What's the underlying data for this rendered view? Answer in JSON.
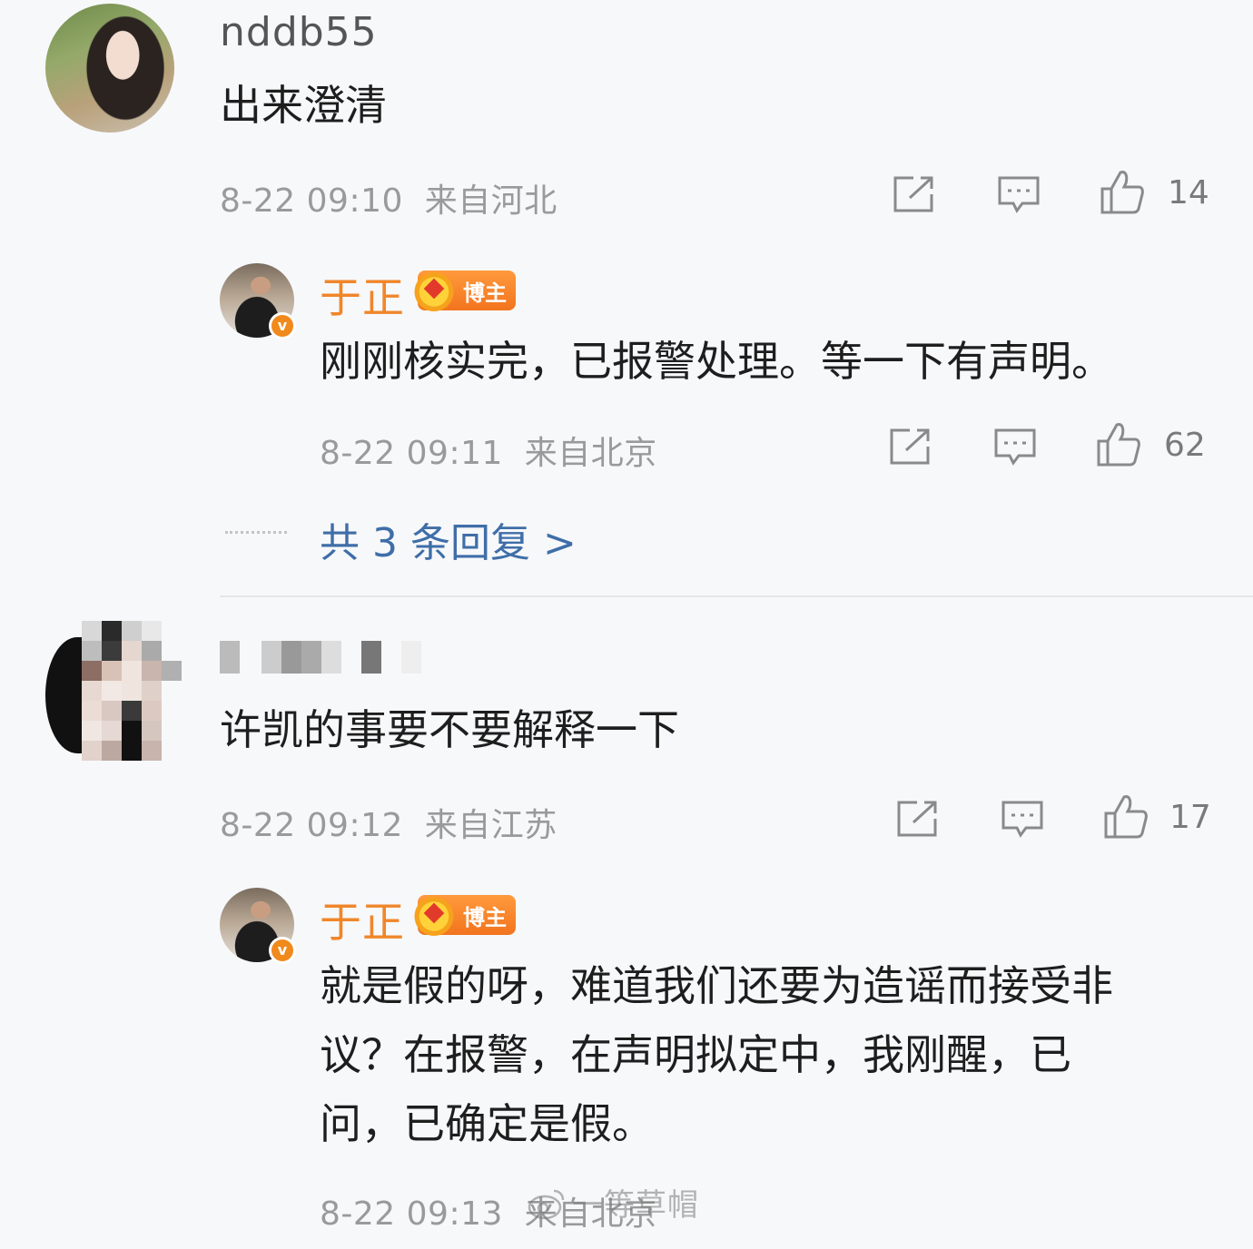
{
  "comments": [
    {
      "username": "nddb55",
      "text": "出来澄清",
      "time": "8-22 09:10",
      "location": "来自河北",
      "likes": "14",
      "reply": {
        "username": "于正",
        "badge": "博主",
        "text": "刚刚核实完，已报警处理。等一下有声明。",
        "time": "8-22 09:11",
        "location": "来自北京",
        "likes": "62"
      },
      "more_replies": "共 3 条回复 >"
    },
    {
      "text": "许凯的事要不要解释一下",
      "time": "8-22 09:12",
      "location": "来自江苏",
      "likes": "17",
      "reply": {
        "username": "于正",
        "badge": "博主",
        "text_lines": [
          "就是假的呀，难道我们还要为造谣而接受非",
          "议？在报警，在声明拟定中，我刚醒，已",
          "问，已确定是假。"
        ],
        "time": "8-22 09:13",
        "location": "来自北京"
      }
    }
  ],
  "verified_mark": "v",
  "watermark": "一等草帽",
  "icons": {
    "share": "share-icon",
    "comment": "comment-icon",
    "like": "thumbs-up-icon",
    "verified": "verified-v-icon",
    "crown": "crown-icon"
  },
  "colors": {
    "background": "#f7f8fa",
    "vip_name": "#f0862a",
    "link": "#3f6ea8",
    "meta": "#9a9a9a"
  }
}
